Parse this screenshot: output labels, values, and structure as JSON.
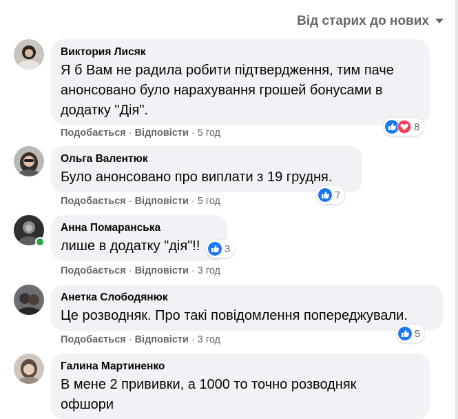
{
  "sort_label": "Від старих до нових",
  "actions": {
    "like": "Подобається",
    "reply": "Відповісти",
    "sep": "·"
  },
  "colors": {
    "like_blue": "#1877f2",
    "love_red": "#f33e58",
    "online_green": "#31a24c"
  },
  "comments": [
    {
      "author": "Виктория Лисяк",
      "text": "Я б Вам не радила робити підтвердження, тим паче анонсовано було нарахування грошей бонусами в додатку \"Дія\".",
      "reactions": [
        "like-icon",
        "love-icon"
      ],
      "reaction_count": "8",
      "time": "5 год"
    },
    {
      "author": "Ольга Валентюк",
      "text": "Було анонсовано про виплати з 19 грудня.",
      "reactions": [
        "like-icon"
      ],
      "reaction_count": "7",
      "time": "5 год"
    },
    {
      "author": "Анна Помаранська",
      "text": "лише в додатку \"дія\"!!",
      "reactions": [
        "like-icon"
      ],
      "reaction_count": "3",
      "time": "3 год",
      "online": true
    },
    {
      "author": "Анетка Слободянюк",
      "text": "Це розводняк. Про такі повідомлення попереджували.",
      "reactions": [
        "like-icon"
      ],
      "reaction_count": "5",
      "time": "3 год"
    },
    {
      "author": "Галина Мартиненко",
      "text": "В мене 2 прививки, а 1000 то точно розводняк офшори",
      "reactions": [],
      "reaction_count": "",
      "time": ""
    }
  ]
}
